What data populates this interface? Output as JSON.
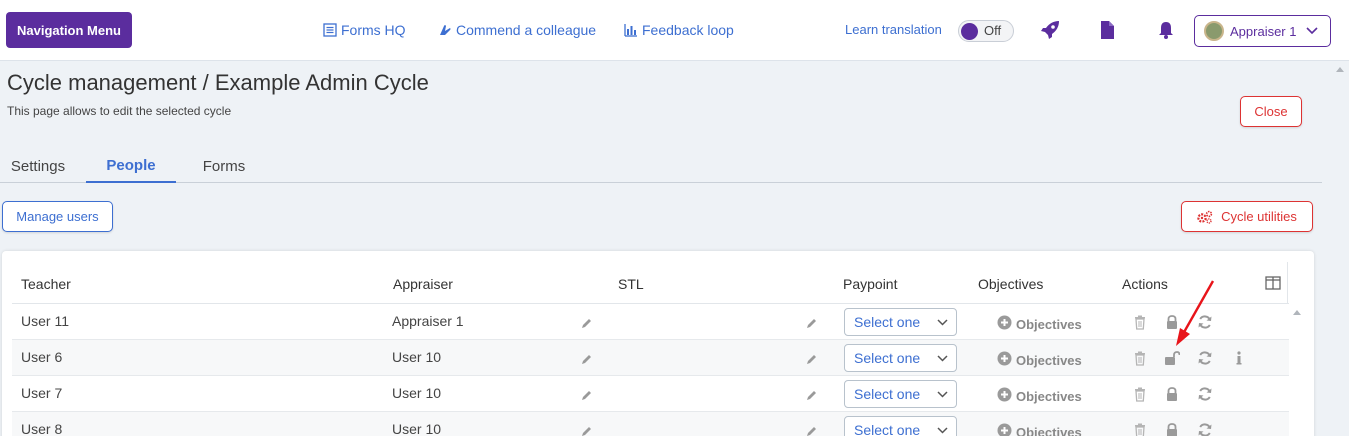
{
  "header": {
    "nav_menu": "Navigation Menu",
    "links": [
      {
        "label": "Forms HQ",
        "icon": "list-icon"
      },
      {
        "label": "Commend a colleague",
        "icon": "hands-icon"
      },
      {
        "label": "Feedback loop",
        "icon": "bar-chart-icon"
      }
    ],
    "learn_translation": "Learn translation",
    "toggle_state": "Off",
    "user_name": "Appraiser 1"
  },
  "page": {
    "title": "Cycle management / Example Admin Cycle",
    "description": "This page allows to edit the selected cycle",
    "close": "Close"
  },
  "tabs": [
    {
      "label": "Settings",
      "active": false
    },
    {
      "label": "People",
      "active": true
    },
    {
      "label": "Forms",
      "active": false
    }
  ],
  "toolbar": {
    "manage_users": "Manage users",
    "cycle_utilities": "Cycle utilities"
  },
  "table": {
    "columns": [
      "Teacher",
      "Appraiser",
      "STL",
      "Paypoint",
      "Objectives",
      "Actions"
    ],
    "rows": [
      {
        "teacher": "User 11",
        "appraiser": "Appraiser 1",
        "paypoint": "Select one",
        "objectives": "Objectives",
        "locked": true,
        "info": false
      },
      {
        "teacher": "User 6",
        "appraiser": "User 10",
        "paypoint": "Select one",
        "objectives": "Objectives",
        "locked": false,
        "info": true
      },
      {
        "teacher": "User 7",
        "appraiser": "User 10",
        "paypoint": "Select one",
        "objectives": "Objectives",
        "locked": true,
        "info": false
      },
      {
        "teacher": "User 8",
        "appraiser": "User 10",
        "paypoint": "Select one",
        "objectives": "Objectives",
        "locked": true,
        "info": false
      }
    ]
  },
  "colors": {
    "brand_purple": "#5b2d9e",
    "link_blue": "#3d6fd1",
    "danger_red": "#dd3333",
    "annotation_arrow": "#e8141a"
  }
}
